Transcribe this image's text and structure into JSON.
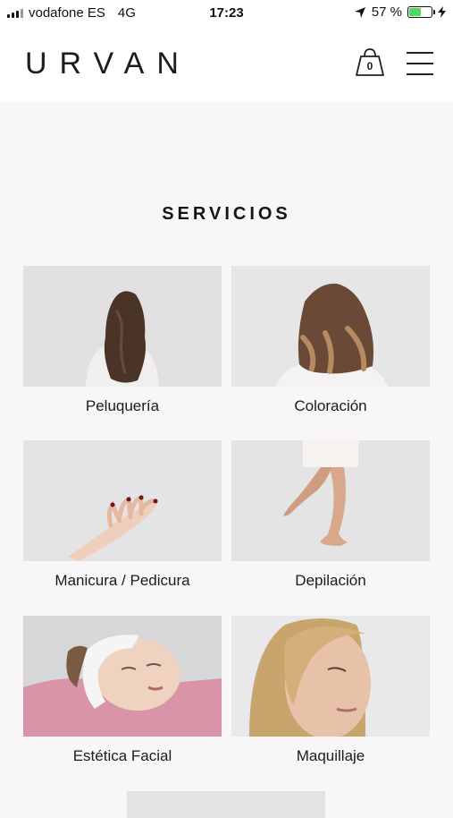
{
  "status_bar": {
    "carrier": "vodafone ES",
    "network": "4G",
    "time": "17:23",
    "battery_percent": "57 %",
    "battery_level": 0.57
  },
  "header": {
    "logo": "URVAN",
    "cart_count": "0"
  },
  "section": {
    "title": "SERVICIOS"
  },
  "services": [
    {
      "label": "Peluquería"
    },
    {
      "label": "Coloración"
    },
    {
      "label": "Manicura / Pedicura"
    },
    {
      "label": "Depilación"
    },
    {
      "label": "Estética Facial"
    },
    {
      "label": "Maquillaje"
    }
  ],
  "colors": {
    "page_bg": "#f8f6f6",
    "battery_fill": "#4cd964"
  }
}
